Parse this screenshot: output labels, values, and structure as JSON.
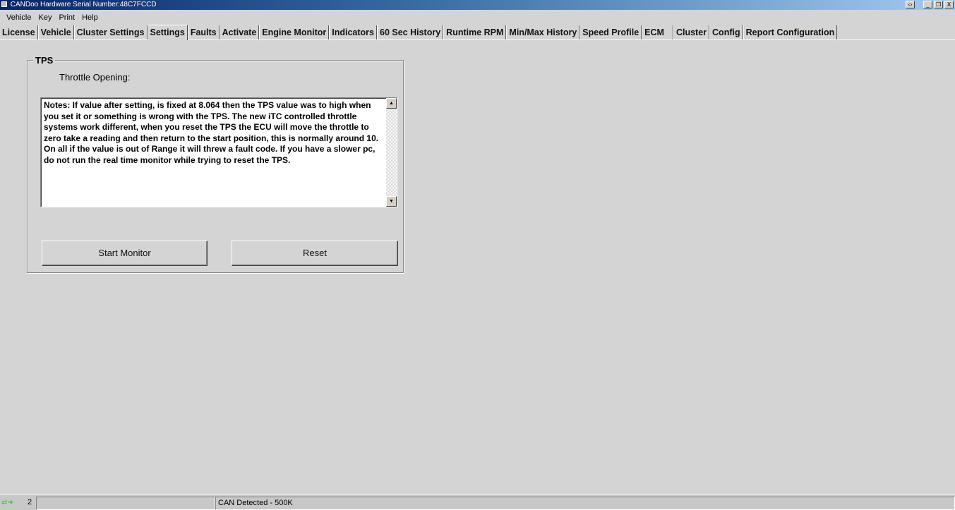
{
  "window": {
    "title": "CANDoo Hardware Serial Number:48C7FCCD",
    "controls": [
      "‹›",
      "_",
      "❐",
      "X"
    ]
  },
  "menu": [
    "Vehicle",
    "Key",
    "Print",
    "Help"
  ],
  "tabs": [
    {
      "label": "License"
    },
    {
      "label": "Vehicle"
    },
    {
      "label": "Cluster Settings"
    },
    {
      "label": "Settings",
      "active": true
    },
    {
      "label": "Faults"
    },
    {
      "label": "Activate"
    },
    {
      "label": "Engine Monitor"
    },
    {
      "label": "Indicators"
    },
    {
      "label": "60 Sec History"
    },
    {
      "label": "Runtime RPM"
    },
    {
      "label": "Min/Max History"
    },
    {
      "label": "Speed Profile"
    },
    {
      "label": "ECM"
    },
    {
      "label": "Cluster"
    },
    {
      "label": "Config"
    },
    {
      "label": "Report Configuration"
    }
  ],
  "tps": {
    "group_title": "TPS",
    "throttle_label": "Throttle Opening:",
    "notes": "Notes: If value after setting, is fixed at 8.064 then the TPS value was to high when you set it or something is wrong with the TPS.  The new iTC controlled throttle systems work different, when you reset the TPS the ECU will move the throttle to zero take a reading and then return to the start position, this is normally around 10. On all if the value is out of Range it will threw a fault code. If you have a slower pc, do not run the real time monitor while trying to reset the TPS.",
    "start_monitor_label": "Start Monitor",
    "reset_label": "Reset"
  },
  "status": {
    "count": "2",
    "connection_text": "CAN Detected - 500K",
    "icon": "connection-arrows-icon",
    "icon_color": "#2ecc2e"
  }
}
